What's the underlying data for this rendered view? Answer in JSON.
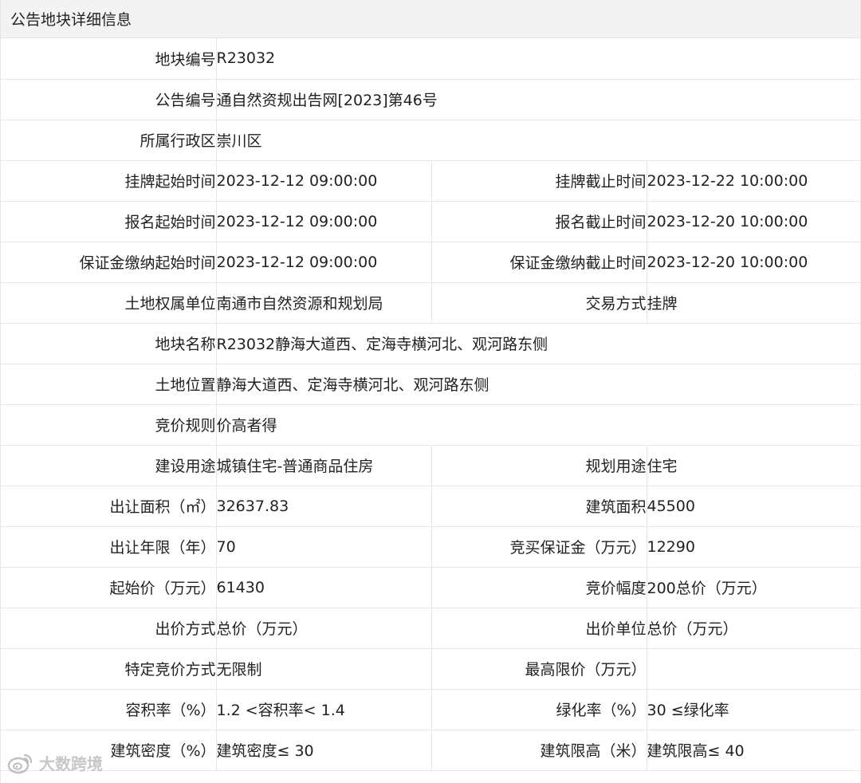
{
  "header": {
    "title": "公告地块详细信息"
  },
  "rows": [
    {
      "label": "地块编号",
      "value": "R23032"
    },
    {
      "label": "公告编号",
      "value": "通自然资规出告网[2023]第46号"
    },
    {
      "label": "所属行政区",
      "value": "崇川区"
    },
    {
      "label": "挂牌起始时间",
      "value": "2023-12-12 09:00:00",
      "label2": "挂牌截止时间",
      "value2": "2023-12-22 10:00:00"
    },
    {
      "label": "报名起始时间",
      "value": "2023-12-12 09:00:00",
      "label2": "报名截止时间",
      "value2": "2023-12-20 10:00:00"
    },
    {
      "label": "保证金缴纳起始时间",
      "value": "2023-12-12 09:00:00",
      "label2": "保证金缴纳截止时间",
      "value2": "2023-12-20 10:00:00"
    },
    {
      "label": "土地权属单位",
      "value": "南通市自然资源和规划局",
      "label2": "交易方式",
      "value2": "挂牌"
    },
    {
      "label": "地块名称",
      "value": "R23032静海大道西、定海寺横河北、观河路东侧"
    },
    {
      "label": "土地位置",
      "value": "静海大道西、定海寺横河北、观河路东侧"
    },
    {
      "label": "竞价规则",
      "value": "价高者得"
    },
    {
      "label": "建设用途",
      "value": "城镇住宅-普通商品住房",
      "label2": "规划用途",
      "value2": "住宅"
    },
    {
      "label": "出让面积（㎡）",
      "value": "32637.83",
      "label2": "建筑面积",
      "value2": "45500"
    },
    {
      "label": "出让年限（年）",
      "value": "70",
      "label2": "竞买保证金（万元）",
      "value2": "12290"
    },
    {
      "label": "起始价（万元）",
      "value": "61430",
      "label2": "竞价幅度",
      "value2": "200总价（万元）"
    },
    {
      "label": "出价方式",
      "value": "总价（万元）",
      "label2": "出价单位",
      "value2": "总价（万元）"
    },
    {
      "label": "特定竞价方式",
      "value": "无限制",
      "label2": "最高限价（万元）",
      "value2": ""
    },
    {
      "label": "容积率（%）",
      "value": "1.2 <容积率< 1.4",
      "label2": "绿化率（%）",
      "value2": "30 ≤绿化率"
    },
    {
      "label": "建筑密度（%）",
      "value": "建筑密度≤ 30",
      "label2": "建筑限高（米）",
      "value2": "建筑限高≤ 40"
    }
  ],
  "watermark": {
    "text": "大数跨境",
    "icon": "weibo-logo-icon"
  }
}
